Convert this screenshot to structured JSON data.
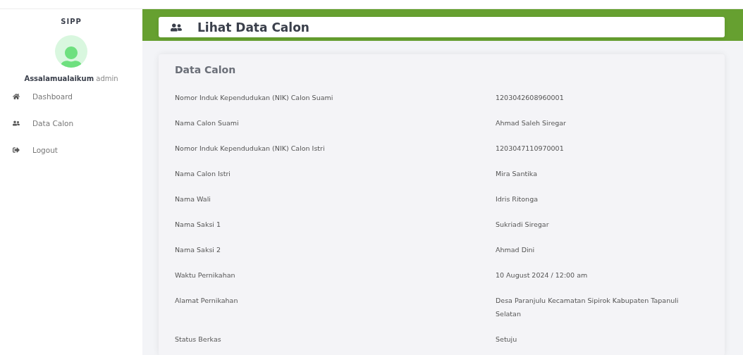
{
  "sidebar": {
    "brand": "SIPP",
    "greeting": {
      "bold": "Assalamualaikum",
      "user": "admin"
    },
    "items": [
      {
        "label": "Dashboard"
      },
      {
        "label": "Data Calon"
      },
      {
        "label": "Logout"
      }
    ]
  },
  "header": {
    "title": "Lihat Data Calon"
  },
  "card": {
    "title": "Data Calon",
    "rows": [
      {
        "label": "Nomor Induk Kependudukan (NIK) Calon Suami",
        "value": "1203042608960001"
      },
      {
        "label": "Nama Calon Suami",
        "value": "Ahmad Saleh Siregar"
      },
      {
        "label": "Nomor Induk Kependudukan (NIK) Calon Istri",
        "value": "1203047110970001"
      },
      {
        "label": "Nama Calon Istri",
        "value": "Mira Santika"
      },
      {
        "label": "Nama Wali",
        "value": "Idris Ritonga"
      },
      {
        "label": "Nama Saksi 1",
        "value": "Sukriadi Siregar"
      },
      {
        "label": "Nama Saksi 2",
        "value": "Ahmad Dini"
      },
      {
        "label": "Waktu Pernikahan",
        "value": "10 August 2024 / 12:00 am"
      },
      {
        "label": "Alamat Pernikahan",
        "value": "Desa Paranjulu Kecamatan Sipirok Kabupaten Tapanuli Selatan"
      },
      {
        "label": "Status Berkas",
        "value": "Setuju"
      }
    ]
  }
}
